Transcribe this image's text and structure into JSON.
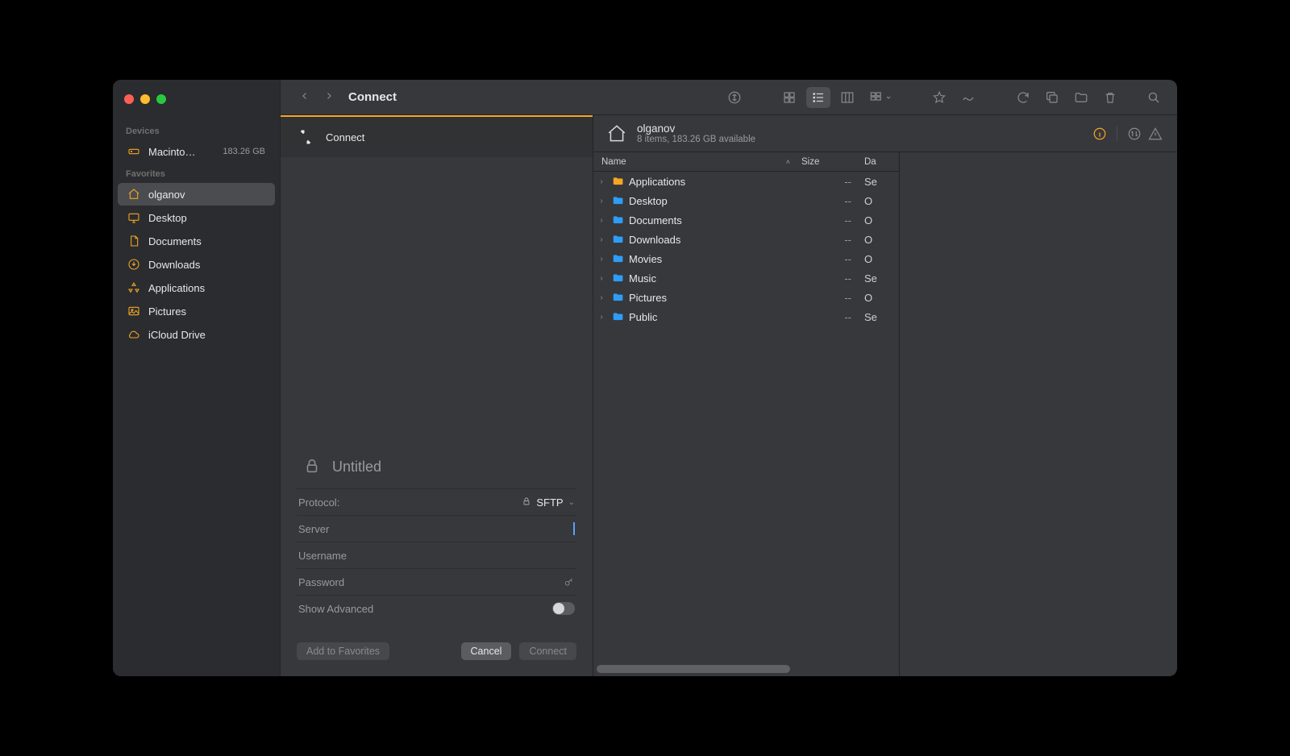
{
  "title": "Connect",
  "sidebar": {
    "devices_heading": "Devices",
    "favorites_heading": "Favorites",
    "devices": [
      {
        "label": "Macinto…",
        "meta": "183.26 GB",
        "icon": "hdd"
      }
    ],
    "favorites": [
      {
        "label": "olganov",
        "icon": "home",
        "selected": true
      },
      {
        "label": "Desktop",
        "icon": "desktop",
        "selected": false
      },
      {
        "label": "Documents",
        "icon": "document",
        "selected": false
      },
      {
        "label": "Downloads",
        "icon": "download",
        "selected": false
      },
      {
        "label": "Applications",
        "icon": "apps",
        "selected": false
      },
      {
        "label": "Pictures",
        "icon": "pictures",
        "selected": false
      },
      {
        "label": "iCloud Drive",
        "icon": "cloud",
        "selected": false
      }
    ]
  },
  "connect": {
    "tab_label": "Connect",
    "form_title": "Untitled",
    "protocol_label": "Protocol:",
    "protocol_value": "SFTP",
    "server_label": "Server",
    "username_label": "Username",
    "password_label": "Password",
    "show_advanced_label": "Show Advanced",
    "btn_add_fav": "Add to Favorites",
    "btn_cancel": "Cancel",
    "btn_connect": "Connect"
  },
  "browser": {
    "path_title": "olganov",
    "path_subtitle": "8 items, 183.26 GB available",
    "columns": {
      "name": "Name",
      "size": "Size",
      "date": "Da"
    },
    "rows": [
      {
        "name": "Applications",
        "size": "--",
        "date": "Se",
        "hilite": true
      },
      {
        "name": "Desktop",
        "size": "--",
        "date": "O",
        "hilite": false
      },
      {
        "name": "Documents",
        "size": "--",
        "date": "O",
        "hilite": false
      },
      {
        "name": "Downloads",
        "size": "--",
        "date": "O",
        "hilite": false
      },
      {
        "name": "Movies",
        "size": "--",
        "date": "O",
        "hilite": false
      },
      {
        "name": "Music",
        "size": "--",
        "date": "Se",
        "hilite": false
      },
      {
        "name": "Pictures",
        "size": "--",
        "date": "O",
        "hilite": false
      },
      {
        "name": "Public",
        "size": "--",
        "date": "Se",
        "hilite": false
      }
    ]
  }
}
